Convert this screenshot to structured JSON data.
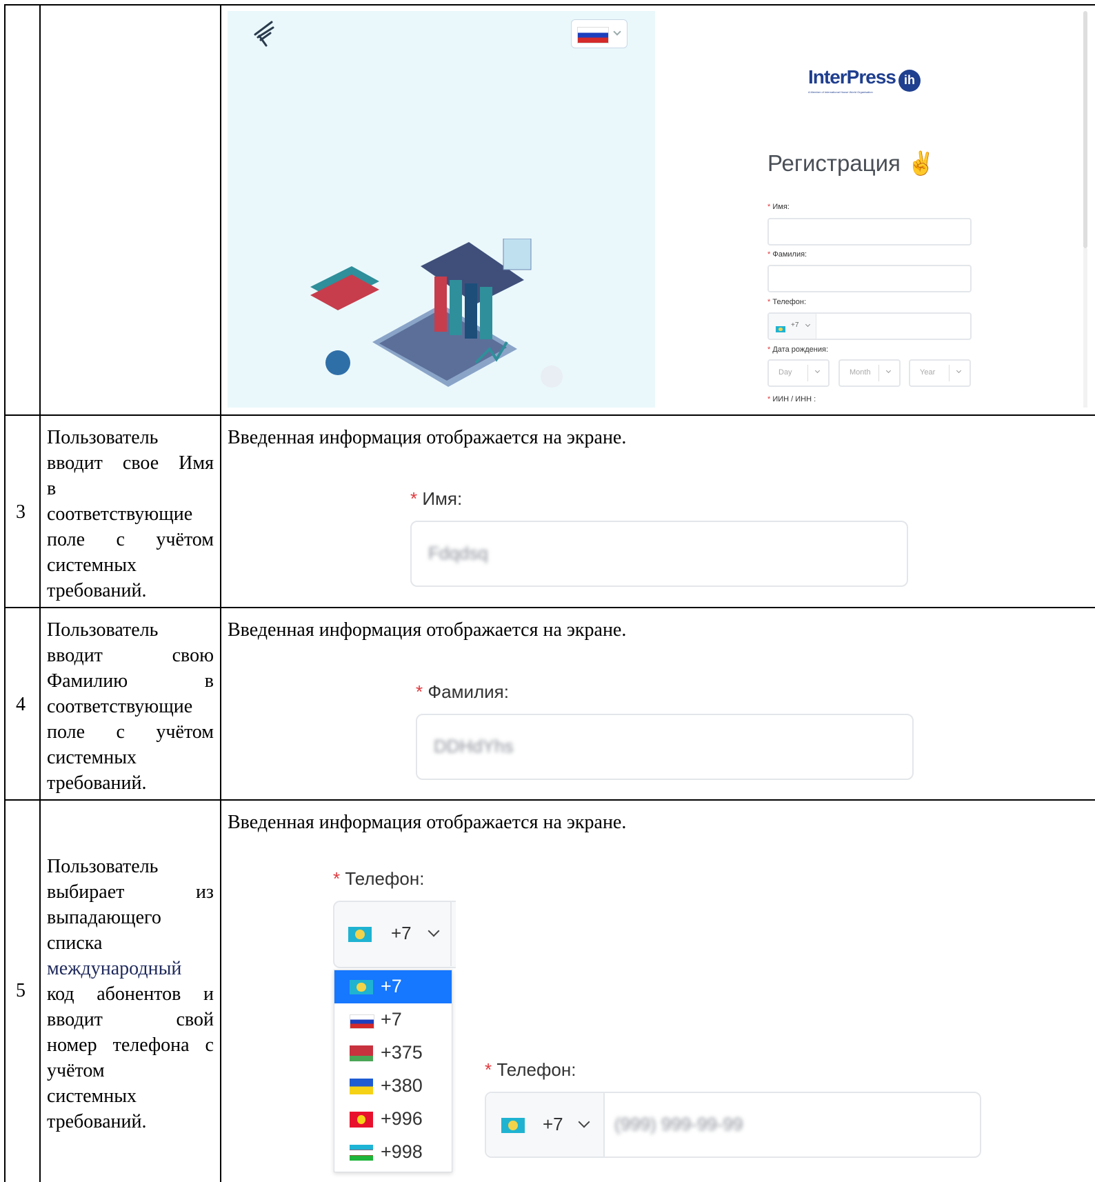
{
  "top_screenshot": {
    "brand": "InterPress",
    "brand_badge": "ih",
    "brand_tagline": "A Member of International House World Organisation",
    "heading": "Регистрация",
    "fields": {
      "name_label": "Имя:",
      "surname_label": "Фамилия:",
      "phone_label": "Телефон:",
      "phone_code": "+7",
      "dob_label": "Дата рождения:",
      "day_placeholder": "Day",
      "month_placeholder": "Month",
      "year_placeholder": "Year",
      "iin_label": "ИИН / ИНН :"
    }
  },
  "rows": [
    {
      "number": "3",
      "description_lines": [
        "Пользователь",
        "вводит свое Имя",
        "в",
        "соответствующие",
        "поле с учётом",
        "системных",
        "требований."
      ],
      "result": "Введенная информация отображается на экране.",
      "field_label": "Имя:",
      "field_value": "Fdqdsq"
    },
    {
      "number": "4",
      "description_lines": [
        "Пользователь",
        "вводит свою",
        "Фамилию в",
        "соответствующие",
        "поле с учётом",
        "системных",
        "требований."
      ],
      "result": "Введенная информация отображается на экране.",
      "field_label": "Фамилия:",
      "field_value": "DDHdYhs"
    },
    {
      "number": "5",
      "description_lines": [
        "Пользователь",
        "выбирает из",
        "выпадающего",
        "списка",
        "международный",
        "код абонентов и",
        "вводит свой",
        "номер телефона с",
        "учётом",
        "системных",
        "требований."
      ],
      "result": "Введенная информация отображается на экране.",
      "field_label": "Телефон:",
      "selected_code": "+7",
      "dropdown_options": [
        "+7",
        "+7",
        "+375",
        "+380",
        "+996",
        "+998"
      ],
      "phone_value": "(999) 999-99-99"
    }
  ],
  "icon_names": [
    "hummingbird-logo-icon",
    "russia-flag-icon",
    "chevron-down-icon",
    "kazakhstan-flag-icon",
    "belarus-flag-icon",
    "ukraine-flag-icon",
    "kyrgyzstan-flag-icon",
    "uzbekistan-flag-icon",
    "victory-hand-icon"
  ]
}
